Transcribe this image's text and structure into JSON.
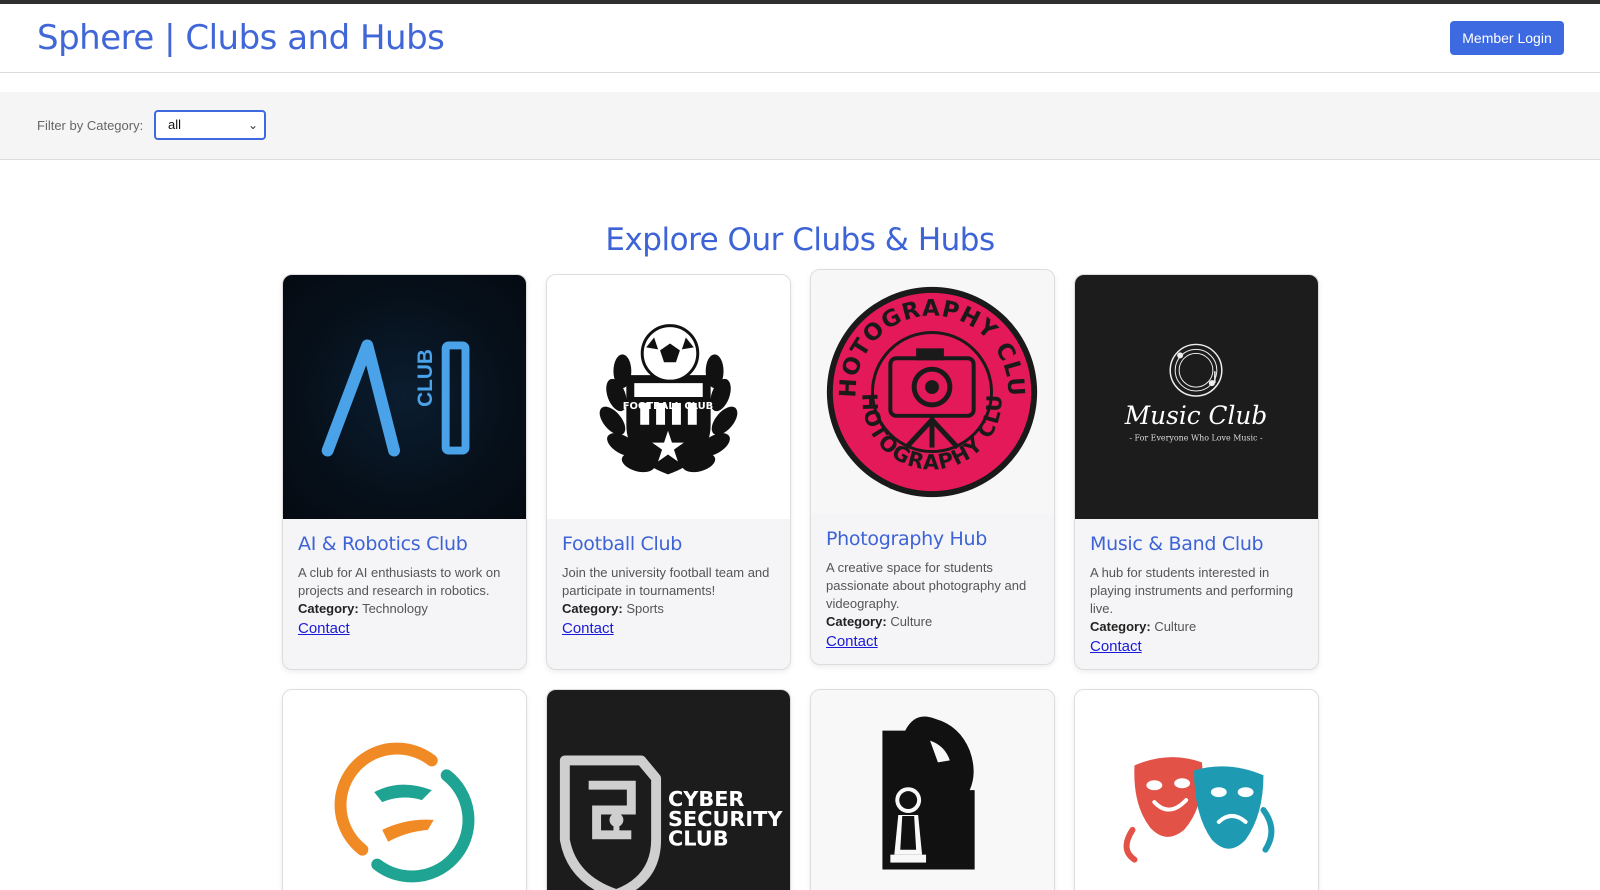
{
  "header": {
    "title": "Sphere | Clubs and Hubs",
    "login_label": "Member Login"
  },
  "filter": {
    "label": "Filter by Category:",
    "selected": "all"
  },
  "main": {
    "title": "Explore Our Clubs & Hubs"
  },
  "category_label": "Category:",
  "clubs": [
    {
      "name": "AI & Robotics Club",
      "description": "A club for AI enthusiasts to work on projects and research in robotics.",
      "category": "Technology",
      "contact": "Contact",
      "logo_text": "CLUB"
    },
    {
      "name": "Football Club",
      "description": "Join the university football team and participate in tournaments!",
      "category": "Sports",
      "contact": "Contact",
      "logo_text": "FOOTBALL CLUB"
    },
    {
      "name": "Photography Hub",
      "description": "A creative space for students passionate about photography and videography.",
      "category": "Culture",
      "contact": "Contact",
      "logo_text": "PHOTOGRAPHY CLUB"
    },
    {
      "name": "Music & Band Club",
      "description": "A hub for students interested in playing instruments and performing live.",
      "category": "Culture",
      "contact": "Contact",
      "logo_text": "Music Club",
      "logo_subtext": "- For Everyone Who Love Music -"
    },
    {
      "logo": "helping-hands-logo"
    },
    {
      "logo_text": "CYBER SECURITY CLUB",
      "logo_lines": [
        "CYBER",
        "SECURITY",
        "CLUB"
      ]
    },
    {
      "logo": "chess-logo"
    },
    {
      "logo": "theatre-masks-logo"
    }
  ],
  "colors": {
    "accent": "#3d63d6",
    "button": "#3d6ae0",
    "link": "#1a1ad6",
    "topbar": "#2f2f2f"
  }
}
